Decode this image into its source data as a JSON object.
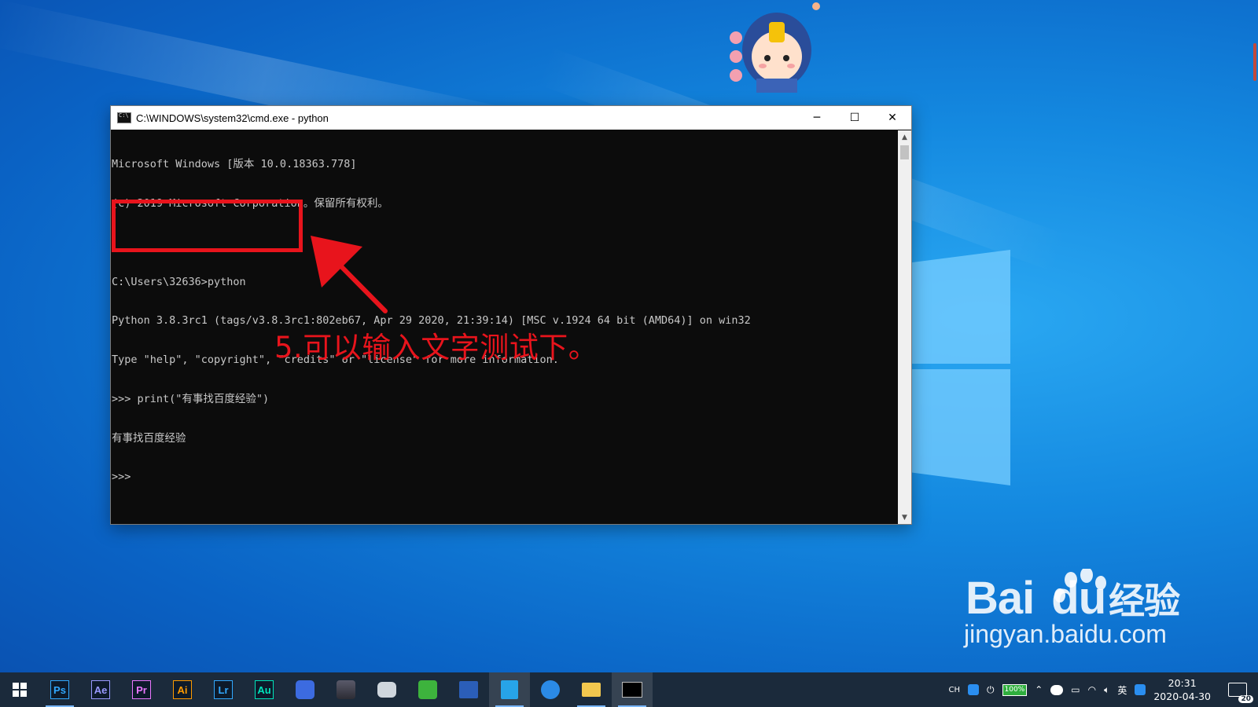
{
  "window": {
    "title": "C:\\WINDOWS\\system32\\cmd.exe - python",
    "minimize": "─",
    "maximize": "☐",
    "close": "✕"
  },
  "console": {
    "lines": [
      "Microsoft Windows [版本 10.0.18363.778]",
      "(c) 2019 Microsoft Corporation。保留所有权利。",
      "",
      "C:\\Users\\32636>python",
      "Python 3.8.3rc1 (tags/v3.8.3rc1:802eb67, Apr 29 2020, 21:39:14) [MSC v.1924 64 bit (AMD64)] on win32",
      "Type \"help\", \"copyright\", \"credits\" or \"license\" for more information.",
      ">>> print(\"有事找百度经验\")",
      "有事找百度经验",
      ">>>"
    ]
  },
  "annotation": {
    "text": "5.可以输入文字测试下。",
    "color": "#e8141c"
  },
  "watermark": {
    "brand_bai": "Bai",
    "brand_du": "du",
    "brand_jingyan": "经验",
    "url": "jingyan.baidu.com"
  },
  "taskbar": {
    "apps": [
      {
        "name": "photoshop",
        "label": "Ps",
        "color": "#31a8ff"
      },
      {
        "name": "after-effects",
        "label": "Ae",
        "color": "#9999ff"
      },
      {
        "name": "premiere",
        "label": "Pr",
        "color": "#ea77ff"
      },
      {
        "name": "illustrator",
        "label": "Ai",
        "color": "#ff9a00"
      },
      {
        "name": "lightroom",
        "label": "Lr",
        "color": "#31a8ff"
      },
      {
        "name": "audition",
        "label": "Au",
        "color": "#00e4bb"
      }
    ],
    "tray": {
      "ime_short": "CH",
      "battery": "100%",
      "lang": "英",
      "time": "20:31",
      "date": "2020-04-30",
      "notifications": "20"
    }
  }
}
